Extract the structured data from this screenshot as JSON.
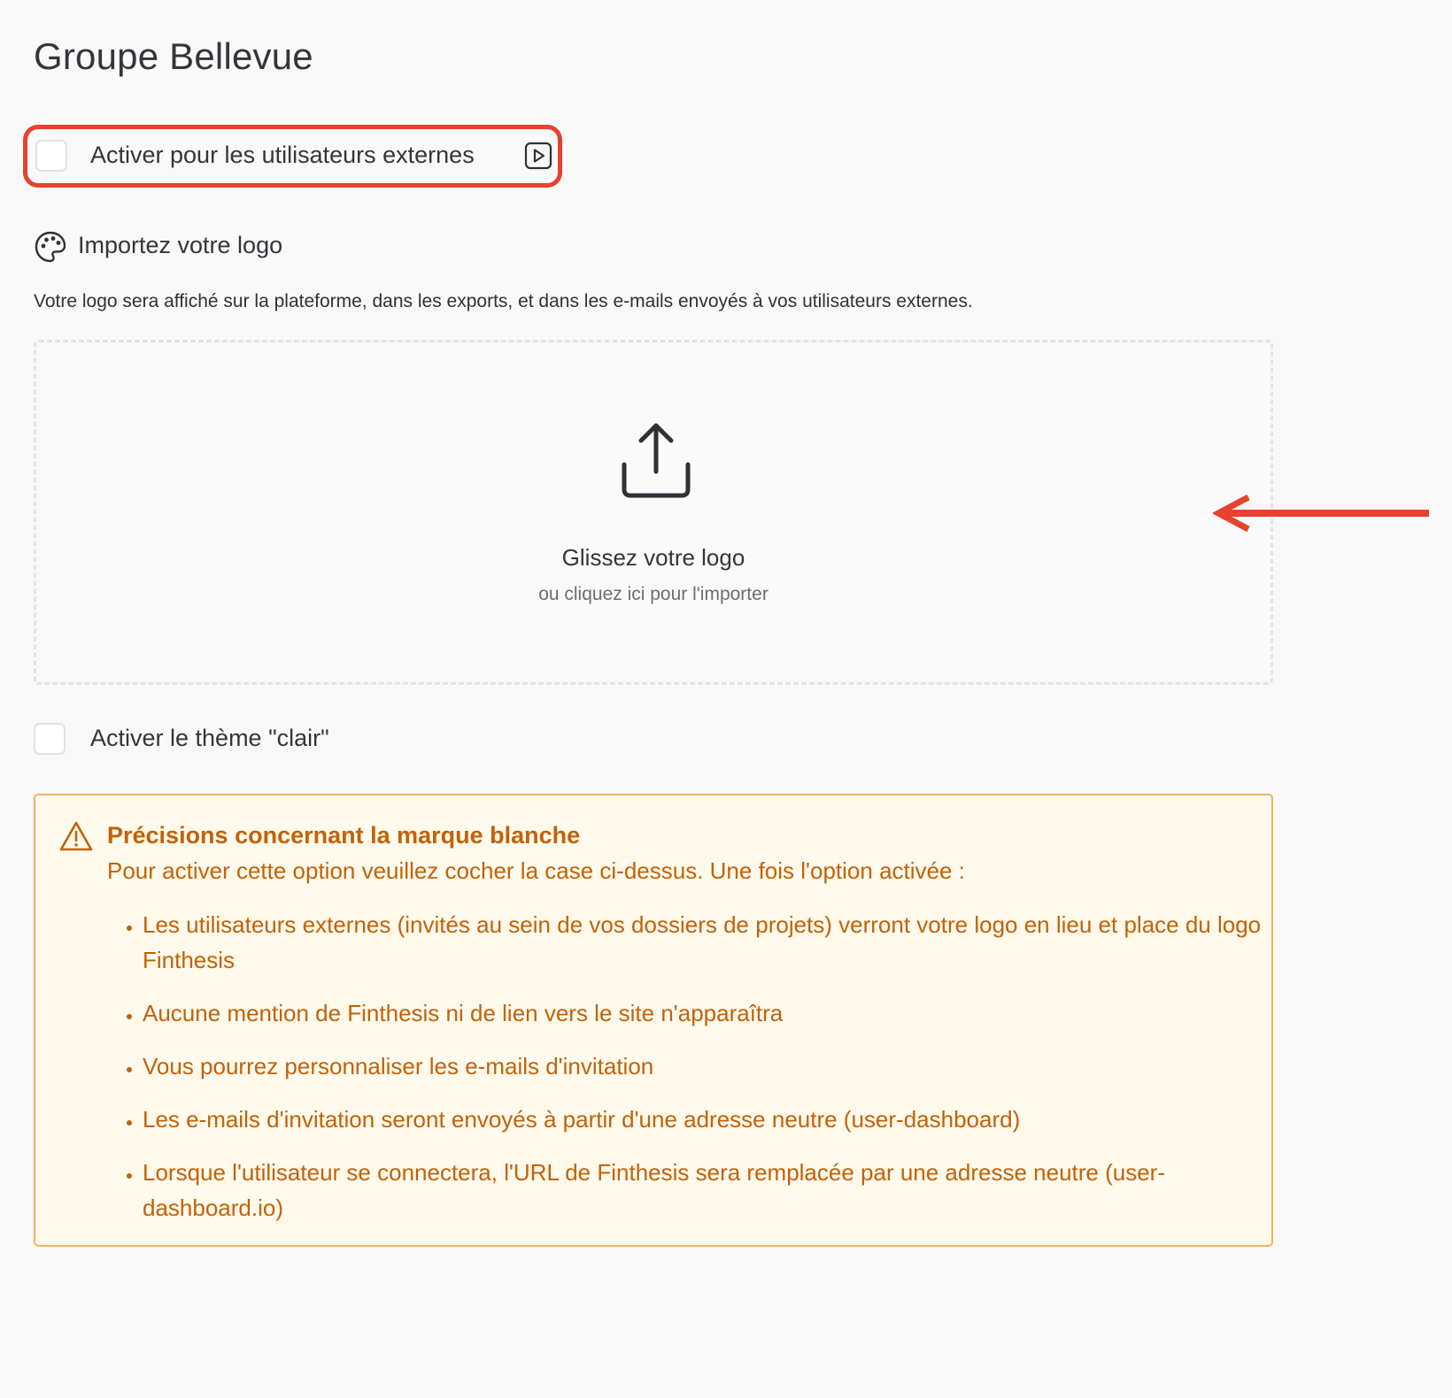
{
  "page": {
    "title": "Groupe Bellevue"
  },
  "external_users": {
    "label": "Activer pour les utilisateurs externes",
    "checked": false,
    "video_icon": "play-video-icon"
  },
  "logo_section": {
    "icon": "palette-icon",
    "title": "Importez votre logo",
    "description": "Votre logo sera affiché sur la plateforme, dans les exports, et dans les e-mails envoyés à vos utilisateurs externes."
  },
  "dropzone": {
    "icon": "upload-icon",
    "title": "Glissez votre logo",
    "subtitle": "ou cliquez ici pour l'importer"
  },
  "light_theme": {
    "label": "Activer le thème \"clair\"",
    "checked": false
  },
  "warning": {
    "icon": "warning-triangle-icon",
    "title": "Précisions concernant la marque blanche",
    "intro": "Pour activer cette option veuillez cocher la case ci-dessus. Une fois l'option activée :",
    "items": [
      "Les utilisateurs externes (invités au sein de vos dossiers de projets) verront votre logo en lieu et place du logo Finthesis",
      "Aucune mention de Finthesis ni de lien vers le site n'apparaîtra",
      "Vous pourrez personnaliser les e-mails d'invitation",
      "Les e-mails d'invitation seront envoyés à partir d'une adresse neutre (user-dashboard)",
      "Lorsque l'utilisateur se connectera, l'URL de Finthesis sera remplacée par une adresse neutre (user-dashboard.io)"
    ]
  },
  "colors": {
    "annotation": "#e8412d",
    "warning_text": "#c2620a",
    "warning_border": "#f0b25f",
    "warning_bg": "#fffaeb"
  }
}
